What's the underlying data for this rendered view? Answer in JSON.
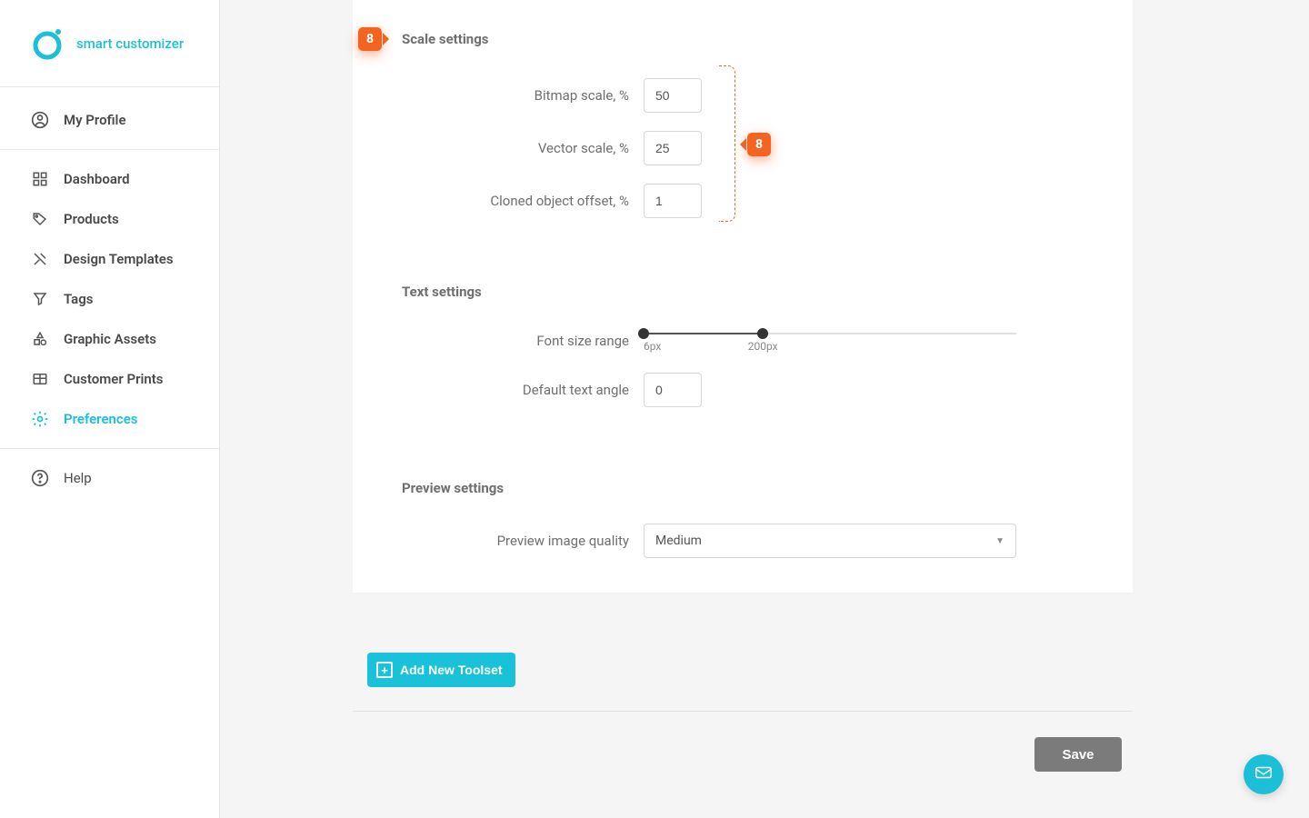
{
  "brand": "smart customizer",
  "sidebar": {
    "profile_label": "My Profile",
    "items": [
      "Dashboard",
      "Products",
      "Design Templates",
      "Tags",
      "Graphic Assets",
      "Customer Prints",
      "Preferences"
    ],
    "help_label": "Help"
  },
  "callouts": {
    "header": "8",
    "inputs": "8"
  },
  "sections": {
    "scale_title": "Scale settings",
    "text_title": "Text settings",
    "preview_title": "Preview settings"
  },
  "fields": {
    "bitmap_label": "Bitmap scale, %",
    "bitmap_value": "50",
    "vector_label": "Vector scale, %",
    "vector_value": "25",
    "cloned_label": "Cloned object offset, %",
    "cloned_value": "1",
    "font_range_label": "Font size range",
    "font_range_min": "6px",
    "font_range_max": "200px",
    "text_angle_label": "Default text angle",
    "text_angle_value": "0",
    "preview_quality_label": "Preview image quality",
    "preview_quality_value": "Medium"
  },
  "buttons": {
    "add_toolset": "Add New Toolset",
    "save": "Save"
  }
}
